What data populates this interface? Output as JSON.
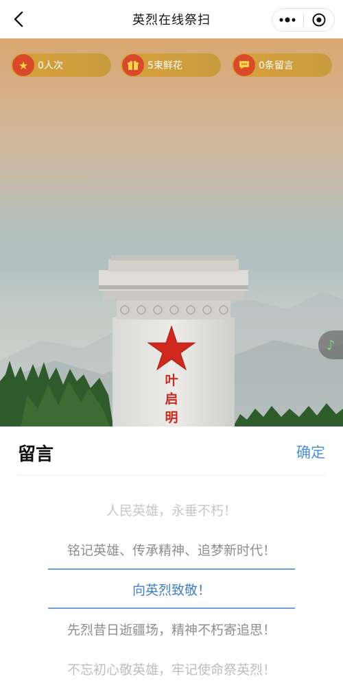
{
  "navbar": {
    "title": "英烈在线祭扫",
    "back_icon": "chevron-left-icon",
    "more_icon": "more-dots-icon",
    "close_icon": "target-circle-icon"
  },
  "stats": [
    {
      "icon": "star-icon",
      "label": "0人次"
    },
    {
      "icon": "gift-icon",
      "label": "5束鲜花"
    },
    {
      "icon": "message-icon",
      "label": "0条留言"
    }
  ],
  "monument": {
    "inscription_chars": [
      "叶",
      "启",
      "明"
    ],
    "star_color": "#d0281e"
  },
  "music": {
    "icon": "music-note-icon"
  },
  "sheet": {
    "title": "留言",
    "confirm_label": "确定",
    "options": [
      "人民英雄，永垂不朽！",
      "铭记英雄、传承精神、追梦新时代！",
      "向英烈致敬！",
      "先烈昔日逝疆场，精神不朽寄追思！",
      "不忘初心敬英雄，牢记使命祭英烈！"
    ],
    "selected_index": 2
  },
  "colors": {
    "accent": "#4a8fd8",
    "pill_gold": "#d8a23a",
    "pill_icon_red": "#d84a2a"
  }
}
